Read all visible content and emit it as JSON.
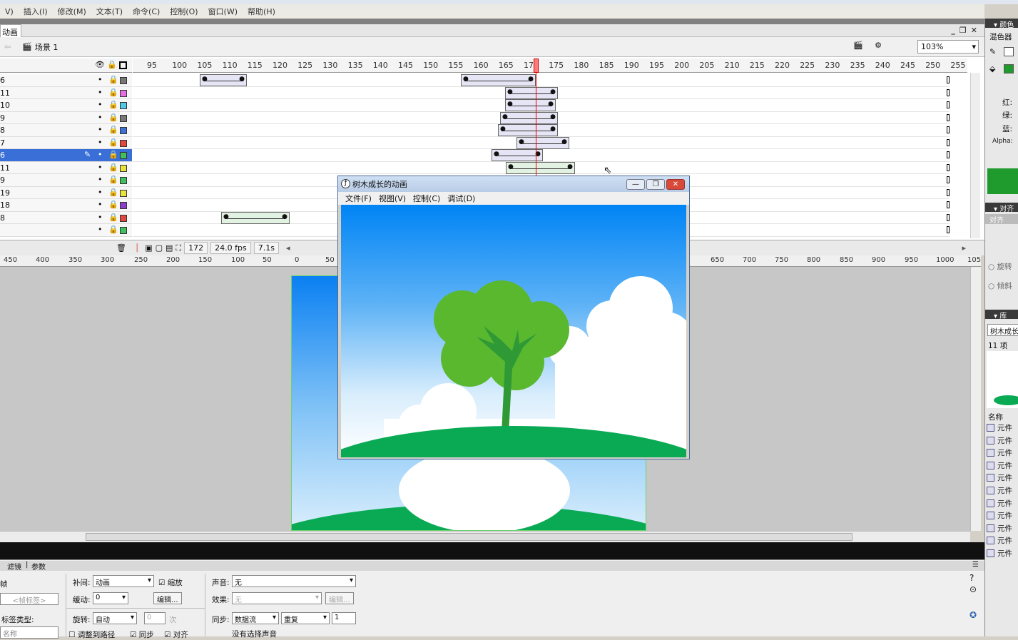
{
  "menubar": [
    "V)",
    "插入(I)",
    "修改(M)",
    "文本(T)",
    "命令(C)",
    "控制(O)",
    "窗口(W)",
    "帮助(H)"
  ],
  "doc_tab": "动画",
  "scene": {
    "name": "场景 1",
    "zoom": "103%"
  },
  "timeline": {
    "ruler": [
      "95",
      "100",
      "105",
      "110",
      "115",
      "120",
      "125",
      "130",
      "135",
      "140",
      "145",
      "150",
      "155",
      "160",
      "165",
      "170",
      "175",
      "180",
      "185",
      "190",
      "195",
      "200",
      "205",
      "210",
      "215",
      "220",
      "225",
      "230",
      "235",
      "240",
      "245",
      "250",
      "255"
    ],
    "layers": [
      {
        "num": "6",
        "color": "#777777"
      },
      {
        "num": "11",
        "color": "#e26ee2"
      },
      {
        "num": "10",
        "color": "#4fc9e5"
      },
      {
        "num": "9",
        "color": "#777777"
      },
      {
        "num": "8",
        "color": "#3f6fd6"
      },
      {
        "num": "7",
        "color": "#e0483f"
      },
      {
        "num": "6",
        "color": "#3fbf5f",
        "selected": true
      },
      {
        "num": "11",
        "color": "#e8e23f"
      },
      {
        "num": "9",
        "color": "#3fbf5f"
      },
      {
        "num": "19",
        "color": "#e8e23f"
      },
      {
        "num": "18",
        "color": "#8b3fcf"
      },
      {
        "num": "8",
        "color": "#e0483f"
      },
      {
        "num": "",
        "color": "#3fbf5f"
      }
    ],
    "current_frame": "172",
    "fps": "24.0 fps",
    "elapsed": "7.1s"
  },
  "h_ruler": [
    "450",
    "400",
    "350",
    "300",
    "250",
    "200",
    "150",
    "100",
    "50",
    "0",
    "50",
    "650",
    "700",
    "750",
    "800",
    "850",
    "900",
    "950",
    "1000",
    "105"
  ],
  "player": {
    "title": "树木成长的动画",
    "menu": [
      "文件(F)",
      "视图(V)",
      "控制(C)",
      "调试(D)"
    ]
  },
  "props": {
    "tabs": [
      "滤镜",
      "参数"
    ],
    "tween_label": "补间:",
    "tween_value": "动画",
    "scale_label": "缩放",
    "ease_label": "缓动:",
    "ease_value": "0",
    "edit_btn": "编辑...",
    "rotate_label": "旋转:",
    "rotate_value": "自动",
    "rotate_count": "0",
    "times": "次",
    "orient_path": "调整到路径",
    "sync": "同步",
    "snap": "对齐",
    "frame_label_placeholder": "<帧标签>",
    "label_type": "标签类型:",
    "name_label": "名称",
    "sound_label": "声音:",
    "sound_value": "无",
    "effect_label": "效果:",
    "effect_value": "无",
    "effect_edit": "编辑...",
    "sync_label": "同步:",
    "sync_value": "数据流",
    "repeat_value": "重复",
    "repeat_count": "1",
    "no_sound": "没有选择声音",
    "left_partial": "帧"
  },
  "right_panel": {
    "color_head": "颜色",
    "mixer": "混色器",
    "red": "红:",
    "green": "绿:",
    "blue": "蓝:",
    "alpha": "Alpha:",
    "fill_color": "#1f9a2c",
    "align_head": "对齐",
    "align_tab": "对齐",
    "rotate": "旋转",
    "skew": "倾斜",
    "lib_head": "库",
    "lib_doc": "树木成长",
    "lib_count": "11 项",
    "lib_name_col": "名称",
    "lib_items": [
      "元件",
      "元件",
      "元件",
      "元件",
      "元件",
      "元件",
      "元件",
      "元件",
      "元件",
      "元件",
      "元件"
    ]
  }
}
